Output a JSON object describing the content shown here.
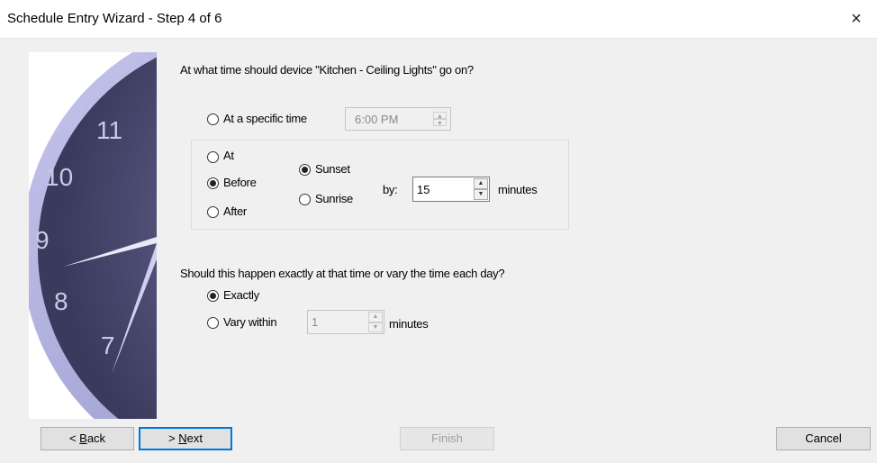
{
  "window": {
    "title": "Schedule Entry Wizard - Step 4 of 6",
    "close_icon": "×"
  },
  "clock": {
    "numbers": [
      "11",
      "10",
      "9",
      "8",
      "7"
    ],
    "colors": {
      "face": "#5a5a8a",
      "rim": "#9d9dd1",
      "hand": "#e6e6f8"
    }
  },
  "question1": "At what time should device \"Kitchen - Ceiling Lights\" go on?",
  "specific_time": {
    "label": "At a specific time",
    "selected": false,
    "value": "6:00 PM"
  },
  "relative": {
    "options": [
      {
        "label": "At",
        "selected": false
      },
      {
        "label": "Before",
        "selected": true
      },
      {
        "label": "After",
        "selected": false
      }
    ],
    "events": [
      {
        "label": "Sunset",
        "selected": true
      },
      {
        "label": "Sunrise",
        "selected": false
      }
    ],
    "by_label": "by:",
    "offset_value": "15",
    "minutes_label": "minutes"
  },
  "question2": "Should this happen exactly at that time or vary the time each day?",
  "variation": {
    "exactly_label": "Exactly",
    "exactly_selected": true,
    "vary_label": "Vary within",
    "vary_selected": false,
    "vary_value": "1",
    "minutes_label": "minutes"
  },
  "buttons": {
    "back": {
      "prefix": "< ",
      "accel": "B",
      "rest": "ack"
    },
    "next": {
      "prefix": "> ",
      "accel": "N",
      "rest": "ext"
    },
    "finish": "Finish",
    "cancel": "Cancel"
  }
}
